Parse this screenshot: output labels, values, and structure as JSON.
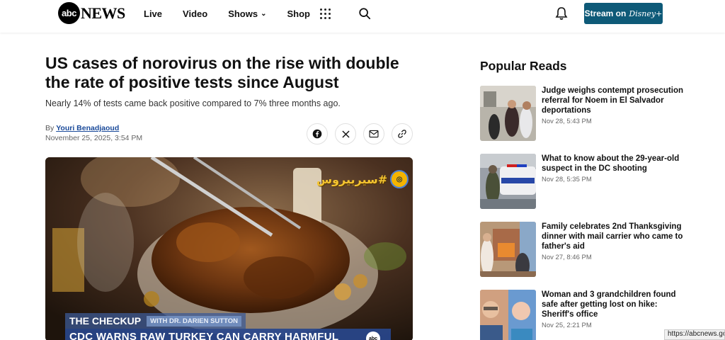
{
  "header": {
    "logo_mark": "abc",
    "logo_text": "NEWS",
    "nav": [
      {
        "label": "Live"
      },
      {
        "label": "Video"
      },
      {
        "label": "Shows"
      },
      {
        "label": "Shop"
      }
    ],
    "stream_label": "Stream on",
    "stream_brand": "Disney+"
  },
  "article": {
    "headline": "US cases of norovirus on the rise with double the rate of positive tests since August",
    "subhead": "Nearly 14% of tests came back positive compared to 7% three months ago.",
    "byline_prefix": "By",
    "author": "Youri Benadjaoud",
    "date": "November 25, 2025, 3:54 PM",
    "share_icons": [
      "facebook-icon",
      "x-icon",
      "email-icon",
      "link-icon"
    ]
  },
  "video": {
    "watermark_text": "#سيربيروس",
    "checkup_title": "THE CHECKUP",
    "checkup_sub": "WITH DR. DARIEN SUTTON",
    "lower_third": "CDC WARNS RAW TURKEY CAN CARRY HARMFUL",
    "bug": "abc"
  },
  "sidebar": {
    "title": "Popular Reads",
    "items": [
      {
        "headline": "Judge weighs contempt prosecution referral for Noem in El Salvador deportations",
        "date": "Nov 28, 5:43 PM"
      },
      {
        "headline": "What to know about the 29-year-old suspect in the DC shooting",
        "date": "Nov 28, 5:35 PM"
      },
      {
        "headline": "Family celebrates 2nd Thanksgiving dinner with mail carrier who came to father's aid",
        "date": "Nov 27, 8:46 PM"
      },
      {
        "headline": "Woman and 3 grandchildren found safe after getting lost on hike: Sheriff's office",
        "date": "Nov 25, 2:21 PM"
      }
    ]
  },
  "status_bar": {
    "url": "https://abcnews.go.c"
  },
  "colors": {
    "accent": "#0e5a78",
    "link": "#1a4a9a",
    "lower_third": "#28468c"
  }
}
